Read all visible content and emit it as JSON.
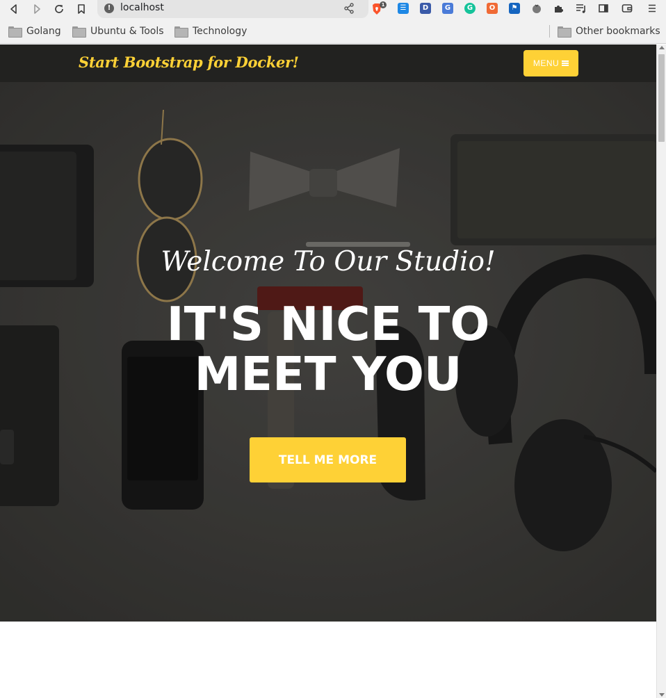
{
  "browser": {
    "url": "localhost",
    "brave_badge": "1",
    "extensions": [
      {
        "name": "checklist-extension-icon",
        "letter": "☰",
        "color": "#1e88e5"
      },
      {
        "name": "d-extension-icon",
        "letter": "D",
        "color": "#3a5aa8"
      },
      {
        "name": "translate-extension-icon",
        "letter": "G",
        "color": "#4a7bd8"
      },
      {
        "name": "grammarly-extension-icon",
        "letter": "G",
        "color": "#15c39a"
      },
      {
        "name": "orange-extension-icon",
        "letter": "O",
        "color": "#f06a35"
      },
      {
        "name": "flag-extension-icon",
        "letter": "⚑",
        "color": "#1565c0"
      }
    ],
    "bookmarks": [
      {
        "label": "Golang"
      },
      {
        "label": "Ubuntu & Tools"
      },
      {
        "label": "Technology"
      }
    ],
    "other_bookmarks": "Other bookmarks"
  },
  "site": {
    "brand": "Start Bootstrap for Docker!",
    "menu_label": "MENU",
    "hero": {
      "subheading": "Welcome To Our Studio!",
      "heading": "IT'S NICE TO MEET YOU",
      "cta_label": "TELL ME MORE"
    }
  },
  "colors": {
    "accent": "#fed136",
    "nav_bg": "#222220",
    "hero_bg": "#403f3c"
  }
}
